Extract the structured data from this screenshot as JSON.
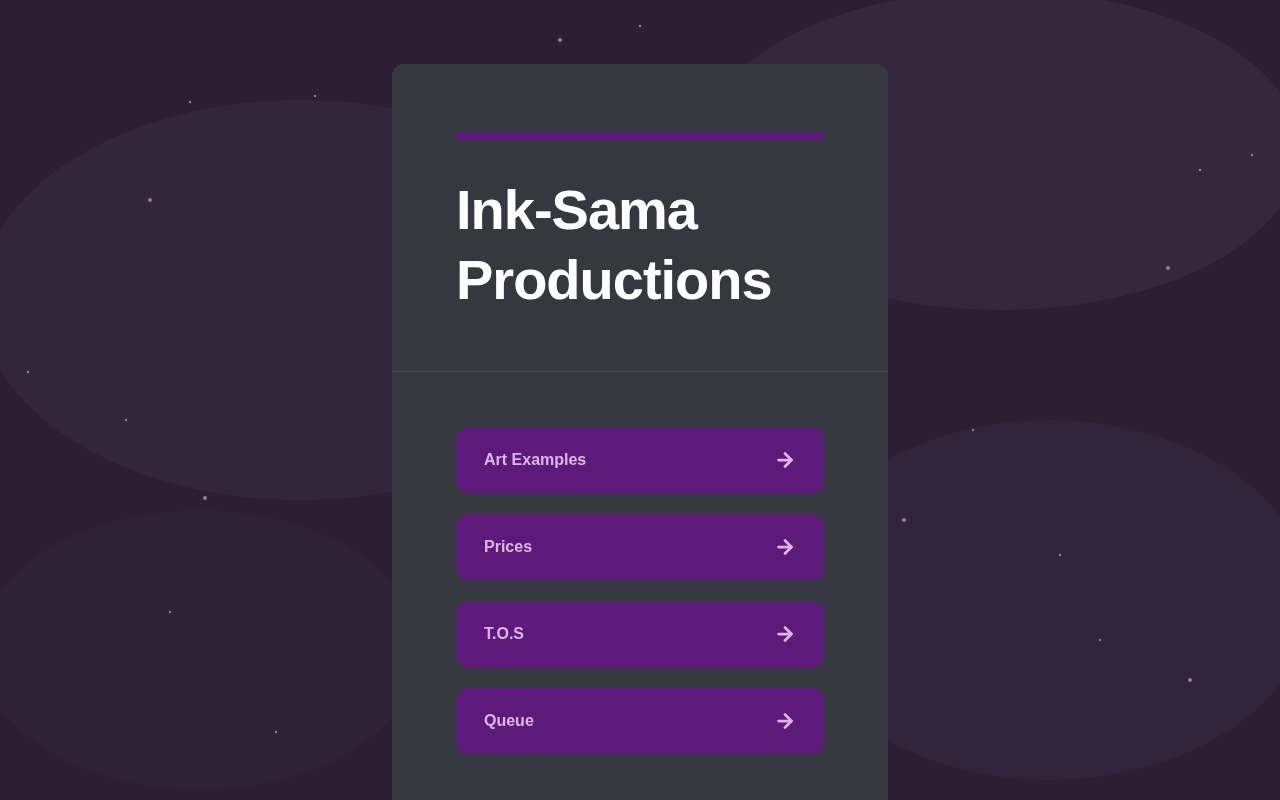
{
  "title": "Ink-Sama Productions",
  "links": [
    {
      "label": "Art Examples"
    },
    {
      "label": "Prices"
    },
    {
      "label": "T.O.S"
    },
    {
      "label": "Queue"
    }
  ]
}
